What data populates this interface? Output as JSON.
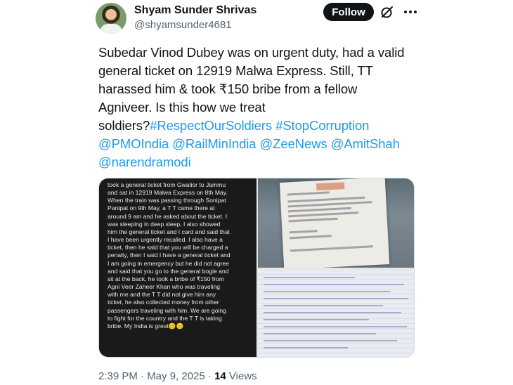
{
  "author": {
    "display_name": "Shyam Sunder Shrivas",
    "handle": "@shyamsunder4681"
  },
  "actions": {
    "follow_label": "Follow"
  },
  "tweet": {
    "lines": [
      "Subedar Vinod Dubey was on urgent duty, had a valid",
      "general ticket on 12919 Malwa Express. Still, TT",
      "harassed him & took ₹150 bribe from a fellow",
      "Agniveer. Is this how we treat"
    ],
    "line5_text": "soldiers?",
    "hashtags": [
      "#RespectOurSoldiers",
      "#StopCorruption"
    ],
    "mentions": [
      "@PMOIndia",
      "@RailMinIndia",
      "@ZeeNews",
      "@AmitShah",
      "@narendramodi"
    ]
  },
  "media": {
    "note_lines": [
      "took a general ticket from Gwalior to Jammu",
      "and sat in 12919 Malwa Express on 8th May.",
      "When the train was passing through Sonipat",
      "Panipat on 9th May, a T T came there at",
      "around 9 am and he asked about the ticket. I",
      "was sleeping in deep sleep, I also showed",
      "him the general ticket and I card and said that",
      "I have been urgently recalled. I also have a",
      "ticket, then he said that you will be charged a",
      "penalty, then I said I have a general ticket and",
      "I am going in emergency but he did not agree",
      "and said that you go to the general bogie and",
      "sit at the back, he took a bribe of ₹150 from",
      "Agni Veer Zaheer Khan who was traveling",
      "with me and the T T did not give him any",
      "ticket, he also collected money from other",
      "passengers traveling with him. We are going",
      "to fight for the country and the T T is taking",
      "bribe. My India is great😑😑"
    ]
  },
  "meta": {
    "timestamp": "2:39 PM · May 9, 2025 · ",
    "views_count": "14",
    "views_label": " Views"
  }
}
